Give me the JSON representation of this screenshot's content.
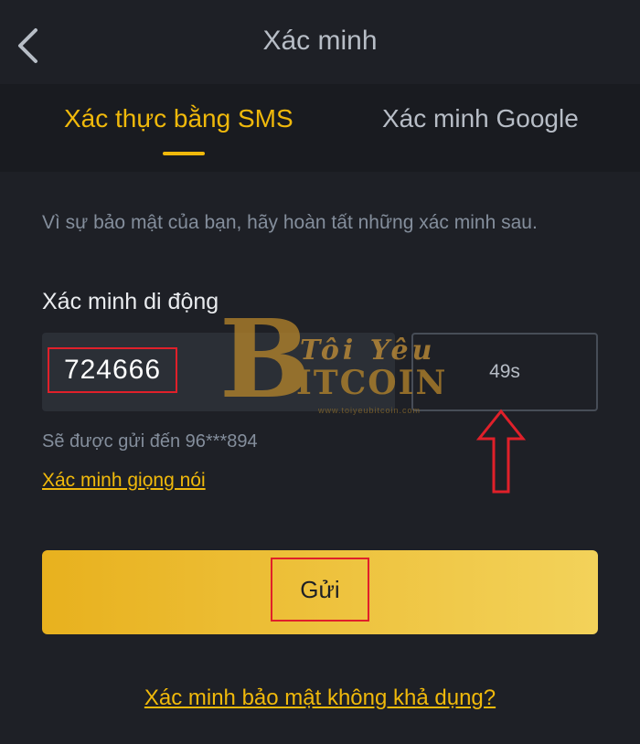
{
  "header": {
    "title": "Xác minh",
    "back_icon": "chevron-left-icon"
  },
  "tabs": [
    {
      "label": "Xác thực bằng SMS",
      "active": true
    },
    {
      "label": "Xác minh Google",
      "active": false
    }
  ],
  "form": {
    "hint": "Vì sự bảo mật của bạn, hãy hoàn tất những xác minh sau.",
    "field_label": "Xác minh di động",
    "code_value": "724666",
    "timer": "49s",
    "sent_to": "Sẽ được gửi đến 96***894",
    "voice_link": "Xác minh giọng nói",
    "submit_label": "Gửi",
    "unavailable_link": "Xác minh bảo mật không khả dụng?"
  },
  "watermark": {
    "logo_top": "Tôi Yêu",
    "logo_main": "ITCOIN",
    "logo_url": "www.toiyeubitcoin.com"
  },
  "colors": {
    "accent": "#f0b90b",
    "background": "#1e2026",
    "annotation": "#e0202a"
  }
}
